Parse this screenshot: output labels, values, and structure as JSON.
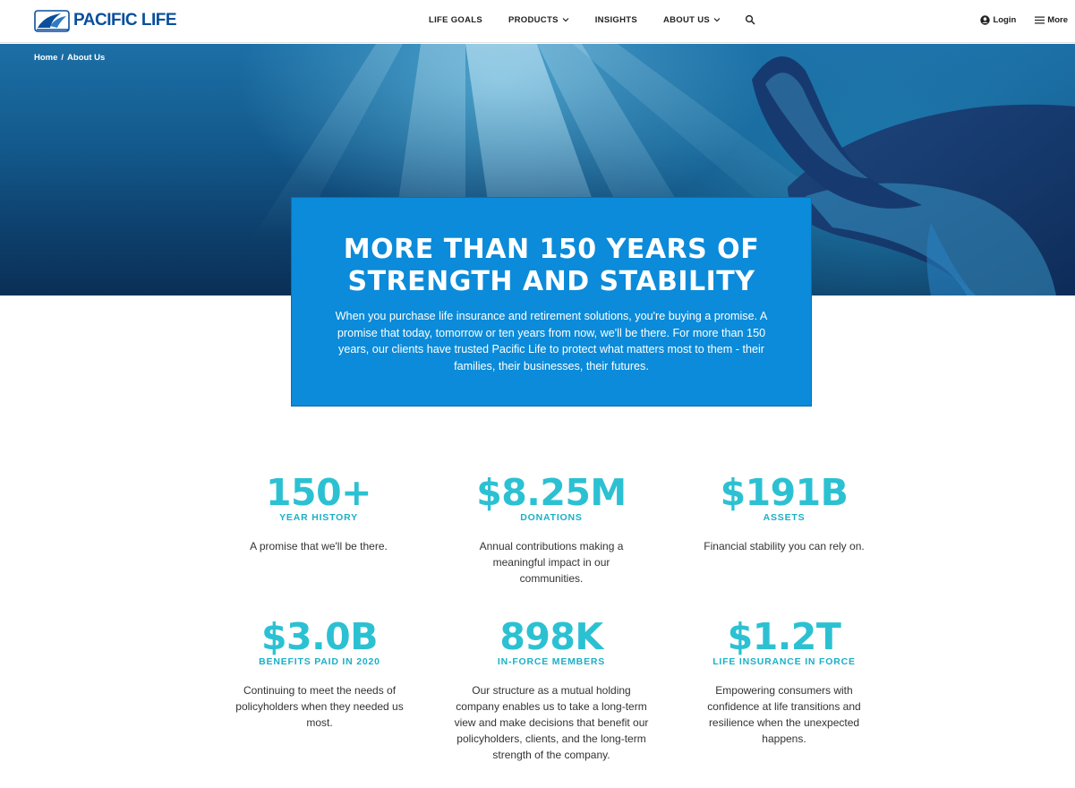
{
  "brand": {
    "name": "PACIFIC LIFE",
    "color": "#0a4f9c"
  },
  "nav": {
    "items": [
      {
        "label": "LIFE GOALS",
        "has_dropdown": false
      },
      {
        "label": "PRODUCTS",
        "has_dropdown": true
      },
      {
        "label": "INSIGHTS",
        "has_dropdown": false
      },
      {
        "label": "ABOUT US",
        "has_dropdown": true
      }
    ],
    "search_icon": "search-icon"
  },
  "tools": {
    "login_label": "Login",
    "more_label": "More"
  },
  "breadcrumb": {
    "home": "Home",
    "separator": "/",
    "current": "About Us"
  },
  "hero": {
    "title_line1": "MORE THAN 150 YEARS OF",
    "title_line2": "STRENGTH AND STABILITY",
    "body": "When you purchase life insurance and retirement solutions, you're buying a promise. A promise that today, tomorrow or ten years from now, we'll be there. For more than 150 years, our clients have trusted Pacific Life to protect what matters most to them - their families, their businesses, their futures.",
    "card_color": "#0b8bd9"
  },
  "stats": [
    {
      "value": "150+",
      "label": "YEAR HISTORY",
      "desc": "A promise that we'll be there."
    },
    {
      "value": "$8.25M",
      "label": "DONATIONS",
      "desc": "Annual contributions making a meaningful impact in our communities."
    },
    {
      "value": "$191B",
      "label": "ASSETS",
      "desc": "Financial stability you can rely on."
    },
    {
      "value": "$3.0B",
      "label": "BENEFITS PAID IN 2020",
      "desc": "Continuing to meet the needs of policyholders when they needed us most."
    },
    {
      "value": "898K",
      "label": "IN-FORCE MEMBERS",
      "desc": "Our structure as a mutual holding company enables us to take a long-term view and make decisions that benefit our policyholders, clients, and the long-term strength of the company."
    },
    {
      "value": "$1.2T",
      "label": "LIFE INSURANCE IN FORCE",
      "desc": "Empowering consumers with confidence at life transitions and resilience when the unexpected happens."
    }
  ],
  "colors": {
    "stat_accent": "#2cc1d2"
  }
}
